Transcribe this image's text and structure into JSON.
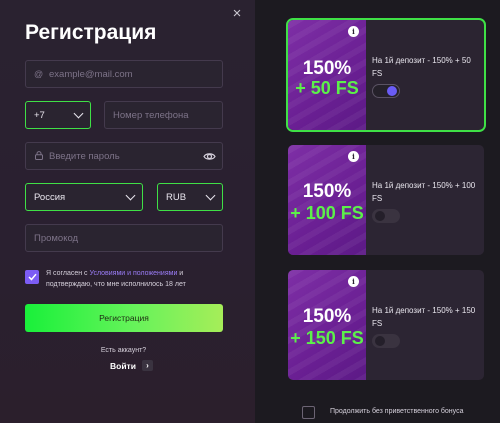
{
  "form": {
    "title": "Регистрация",
    "email_placeholder": "example@mail.com",
    "phone_code": "+7",
    "phone_placeholder": "Номер телефона",
    "password_placeholder": "Введите пароль",
    "country": "Россия",
    "currency": "RUB",
    "promo_placeholder": "Промокод",
    "agree_checked": true,
    "agree_prefix": "Я согласен с ",
    "agree_link": "Условиями и положениями",
    "agree_suffix": " и подтверждаю, что мне исполнилось 18 лет",
    "register_button": "Регистрация",
    "have_account": "Есть аккаунт?",
    "login_label": "Войти",
    "login_arrow": "›",
    "close_icon": "×"
  },
  "bonuses": [
    {
      "percent": "150%",
      "fs": "+ 50 FS",
      "description": "На 1й депозит - 150% + 50 FS",
      "enabled": true,
      "info": "i"
    },
    {
      "percent": "150%",
      "fs": "+ 100 FS",
      "description": "На 1й депозит - 150% + 100 FS",
      "enabled": false,
      "info": "i"
    },
    {
      "percent": "150%",
      "fs": "+ 150 FS",
      "description": "На 1й депозит - 150% + 150 FS",
      "enabled": false,
      "info": "i"
    }
  ],
  "no_bonus": {
    "label": "Продолжить без приветственного бонуса",
    "checked": false
  },
  "colors": {
    "accent_green": "#3fe046",
    "accent_purple": "#7c5cf4",
    "fs_green": "#5cf04a",
    "bonus_bg": "#6a1f93",
    "background": "#1d1b22"
  }
}
